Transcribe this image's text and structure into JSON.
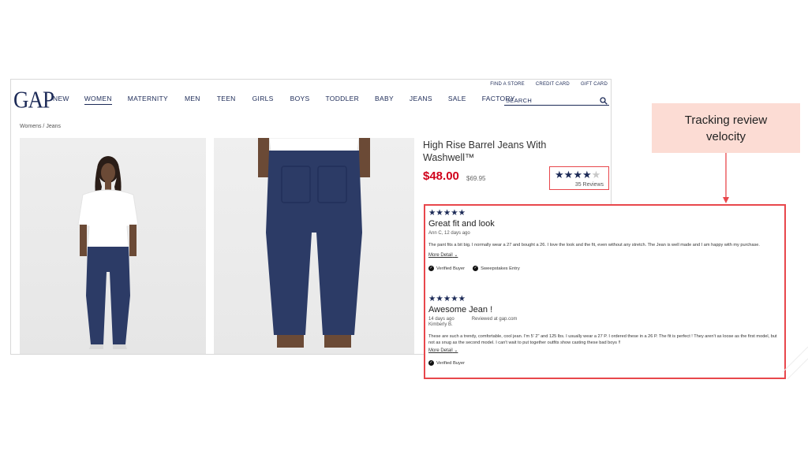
{
  "utility_links": [
    "FIND A STORE",
    "CREDIT CARD",
    "GIFT CARD"
  ],
  "logo": "GAP",
  "nav": [
    "NEW",
    "WOMEN",
    "MATERNITY",
    "MEN",
    "TEEN",
    "GIRLS",
    "BOYS",
    "TODDLER",
    "BABY",
    "JEANS",
    "SALE",
    "FACTORY"
  ],
  "active_nav": "WOMEN",
  "search": {
    "placeholder": "SEARCH",
    "icon": "search-icon"
  },
  "breadcrumb": "Womens / Jeans",
  "product": {
    "title": "High Rise Barrel Jeans With Washwell™",
    "price": "$48.00",
    "original_price": "$69.95",
    "rating": 4,
    "rating_max": 5,
    "reviews_count": "35 Reviews"
  },
  "reviews": [
    {
      "stars": 5,
      "title": "Great fit and look",
      "meta": "Ann C, 12 days ago",
      "body": "The pant fits a bit big. I normally wear a 27 and bought a 26. I love the look and the fit, even without any stretch. The Jean is well made and I am happy with my purchase.",
      "more": "More Detail",
      "badges": [
        "Verified Buyer",
        "Sweepstakes Entry"
      ]
    },
    {
      "stars": 5,
      "title": "Awesome Jean !",
      "meta": "14 days ago",
      "reviewed_at": "Reviewed at gap.com",
      "author": "Kimberly B.",
      "body": "These are such a trendy, comfortable, cool jean. I'm 5' 2\" and 125 lbs. I usually wear a 27 P. I ordered these in a 26 P. The fit is perfect ! They aren't as loose as the first model, but not as snug as the second model. I can't wait to put together outfits show casting these bad boys !!",
      "more": "More Detail",
      "badges": [
        "Verified Buyer"
      ]
    }
  ],
  "annotation": "Tracking review velocity",
  "colors": {
    "brand": "#1c2a57",
    "price": "#d0021b",
    "highlight": "#e8474c",
    "annotation_bg": "#fcdcd4"
  }
}
